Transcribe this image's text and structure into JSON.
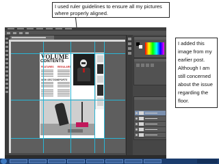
{
  "annotations": {
    "top_note": "I used ruler guidelines to ensure all my pictures where properly aligned.",
    "right_note": "I added this image from my earlier post. Although I am still concerned about the issue regarding the floor."
  },
  "magazine": {
    "title": "VOLUME",
    "subtitle": "CONTENTS",
    "red_heading_1": "FEATURES",
    "red_heading_2": "REGULARS",
    "section_1": "NEW SECTION",
    "section_2": "SPORTS"
  },
  "colors": {
    "guide": "#29b6d6",
    "accent_red": "#c61a1a",
    "photoshop_bg": "#4a4a4a",
    "taskbar": "#1b3d6e"
  }
}
